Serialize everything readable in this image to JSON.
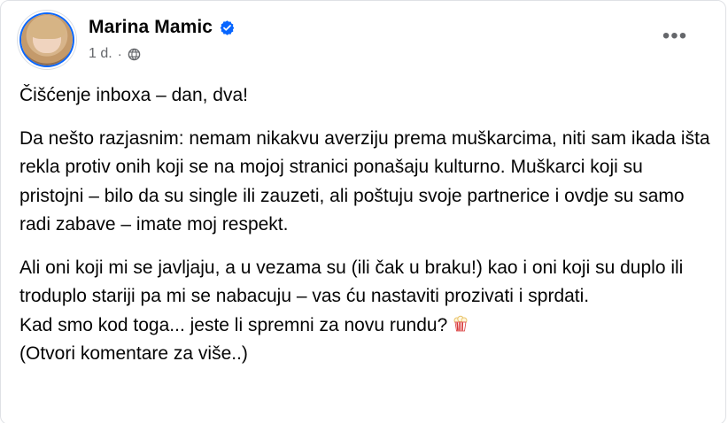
{
  "post": {
    "author_name": "Marina Mamic",
    "verified_icon": "verified-badge-icon",
    "timestamp": "1 d.",
    "separator": "·",
    "audience_icon": "globe-icon",
    "more_label": "•••",
    "body": {
      "line_1": "Čišćenje inboxa – dan, dva!",
      "paragraph_2": "Da nešto razjasnim: nemam nikakvu averziju prema muškarcima, niti sam ikada išta rekla protiv onih koji se na mojoj stranici ponašaju kulturno. Muškarci koji su pristojni – bilo da su single ili zauzeti, ali poštuju svoje partnerice i ovdje su samo radi zabave – imate moj respekt.",
      "paragraph_3": "Ali oni koji mi se javljaju, a u vezama su (ili čak u braku!) kao i oni koji su duplo ili troduplo stariji pa mi se nabacuju – vas ću nastaviti prozivati i sprdati.",
      "line_4": "Kad smo kod toga... jeste li spremni za novu rundu?",
      "emoji": "popcorn-icon",
      "line_5": "(Otvori komentare za više..)"
    },
    "colors": {
      "verified_blue": "#0866ff",
      "secondary_text": "#65676b",
      "primary_text": "#050505"
    }
  }
}
